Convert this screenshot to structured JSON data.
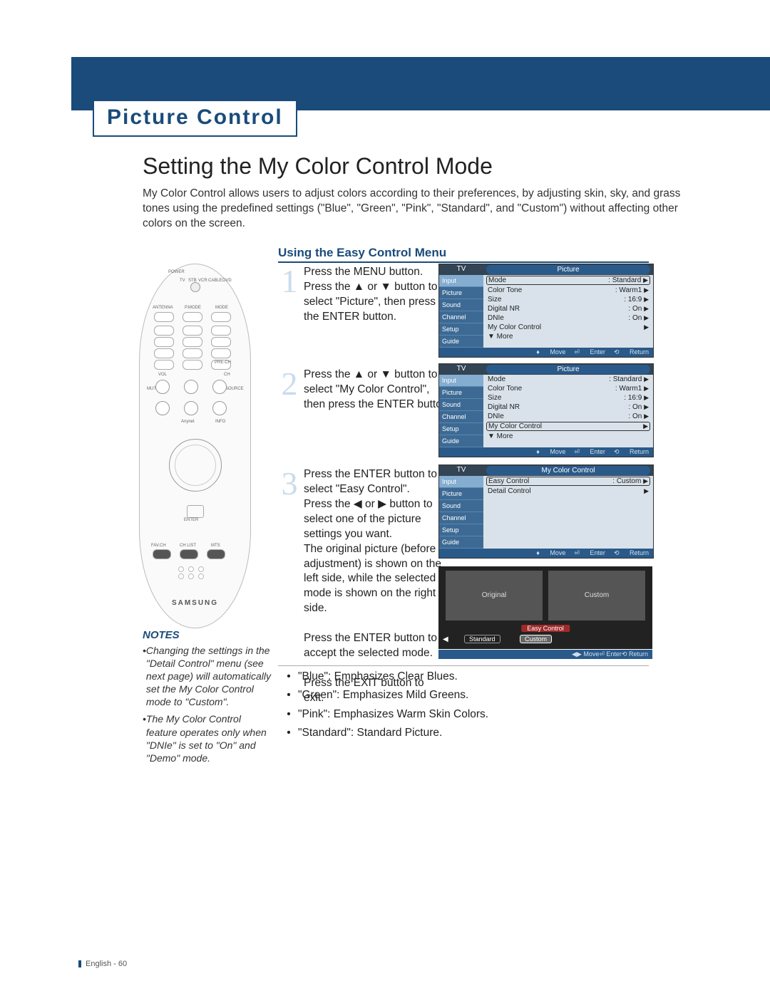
{
  "chapter": "Picture Control",
  "title": "Setting the My Color Control Mode",
  "intro": "My Color Control allows users to adjust colors according to their preferences, by adjusting skin, sky, and grass tones using the predefined settings (\"Blue\", \"Green\", \"Pink\", \"Standard\", and \"Custom\") without affecting other colors on the screen.",
  "subhead": "Using the Easy Control Menu",
  "steps": {
    "s1": "Press the MENU button.\nPress the ▲ or ▼ button to select \"Picture\", then press the ENTER button.",
    "s2": "Press the ▲ or ▼ button to select \"My Color Control\", then press the ENTER button.",
    "s3": "Press the ENTER button to select \"Easy Control\".\nPress the ◀ or ▶ button to select one of the picture settings you want.\nThe original picture (before adjustment) is shown on the left side, while the selected mode is shown on the right side.\n\nPress the ENTER button to accept the selected mode.\n\nPress the EXIT button to exit."
  },
  "osd": {
    "tv": "TV",
    "picture": "Picture",
    "mycolor": "My Color Control",
    "side": [
      "Input",
      "Picture",
      "Sound",
      "Channel",
      "Setup",
      "Guide"
    ],
    "rows": [
      {
        "k": "Mode",
        "v": ": Standard"
      },
      {
        "k": "Color Tone",
        "v": ": Warm1"
      },
      {
        "k": "Size",
        "v": ": 16:9"
      },
      {
        "k": "Digital NR",
        "v": ": On"
      },
      {
        "k": "DNIe",
        "v": ": On"
      },
      {
        "k": "My Color Control",
        "v": ""
      },
      {
        "k": "▼ More",
        "v": ""
      }
    ],
    "mcc_rows": [
      {
        "k": "Easy Control",
        "v": ": Custom"
      },
      {
        "k": "Detail Control",
        "v": ""
      }
    ],
    "ft": {
      "move": "Move",
      "enter": "Enter",
      "return": "Return"
    }
  },
  "preview": {
    "original": "Original",
    "custom": "Custom",
    "banner": "Easy Control",
    "left": "Standard",
    "right": "Custom"
  },
  "bullets": [
    "\"Blue\": Emphasizes Clear Blues.",
    "\"Green\": Emphasizes Mild Greens.",
    "\"Pink\": Emphasizes Warm Skin Colors.",
    "\"Standard\": Standard Picture."
  ],
  "notes": {
    "heading": "NOTES",
    "items": [
      "Changing the settings in the \"Detail Control\" menu (see next page) will automatically set the My Color Control mode to \"Custom\".",
      "The My Color Control feature operates only when \"DNIe\" is set to \"On\" and \"Demo\" mode."
    ]
  },
  "remote": {
    "power": "POWER",
    "tv": "TV",
    "stb": "STB",
    "vcr": "VCR",
    "cable": "CABLE",
    "dvd": "DVD",
    "antenna": "ANTENNA",
    "pmode": "P.MODE",
    "mode": "MODE",
    "vol": "VOL",
    "mute": "MUTE",
    "ch": "CH",
    "source": "SOURCE",
    "info": "INFO",
    "anynet": "Anynet",
    "enter": "ENTER",
    "favch": "FAV.CH",
    "chlist": "CH LIST",
    "mts": "MTS",
    "prech": "PRE-CH",
    "brand": "SAMSUNG"
  },
  "footer": "English - 60"
}
